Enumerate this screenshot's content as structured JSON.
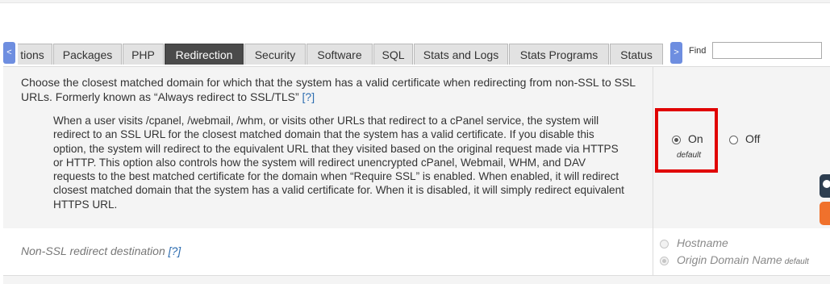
{
  "tabs": {
    "items": [
      {
        "label": "tions"
      },
      {
        "label": "Packages"
      },
      {
        "label": "PHP"
      },
      {
        "label": "Redirection",
        "active": true
      },
      {
        "label": "Security"
      },
      {
        "label": "Software"
      },
      {
        "label": "SQL"
      },
      {
        "label": "Stats and Logs"
      },
      {
        "label": "Stats Programs"
      },
      {
        "label": "Status"
      }
    ],
    "scroll_left_icon": "chevron-left",
    "scroll_right_icon": "chevron-right",
    "scroll_left_glyph": "<",
    "scroll_right_glyph": ">",
    "find_label": "Find",
    "find_value": ""
  },
  "setting1": {
    "title": "Choose the closest matched domain for which that the system has a valid certificate when redirecting from non-SSL to SSL URLs. Formerly known as “Always redirect to SSL/TLS”",
    "help": "[?]",
    "description": "When a user visits /cpanel, /webmail, /whm, or visits other URLs that redirect to a cPanel service, the system will redirect to an SSL URL for the closest matched domain that the system has a valid certificate. If you disable this option, the system will redirect to the equivalent URL that they visited based on the original request made via HTTPS or HTTP. This option also controls how the system will redirect unencrypted cPanel, Webmail, WHM, and DAV requests to the best matched certificate for the domain when “Require SSL” is enabled.  When enabled, it will redirect closest matched domain that the system has a valid certificate for. When it is disabled, it will simply redirect equivalent HTTPS URL.",
    "options": {
      "on": {
        "label": "On",
        "selected": true,
        "note": "default"
      },
      "off": {
        "label": "Off",
        "selected": false
      }
    },
    "highlight_color": "#e00000"
  },
  "setting2": {
    "label": "Non-SSL redirect destination",
    "help": "[?]",
    "options": {
      "hostname": {
        "label": "Hostname",
        "selected": false
      },
      "origin": {
        "label": "Origin Domain Name",
        "selected": true,
        "note": "default"
      }
    }
  },
  "colors": {
    "active_tab": "#4a4a4a",
    "scroll_button": "#6e8ee0",
    "help_link": "#2c6cb0",
    "side_widget_dark": "#2d3e50",
    "side_widget_orange": "#f0712c"
  }
}
